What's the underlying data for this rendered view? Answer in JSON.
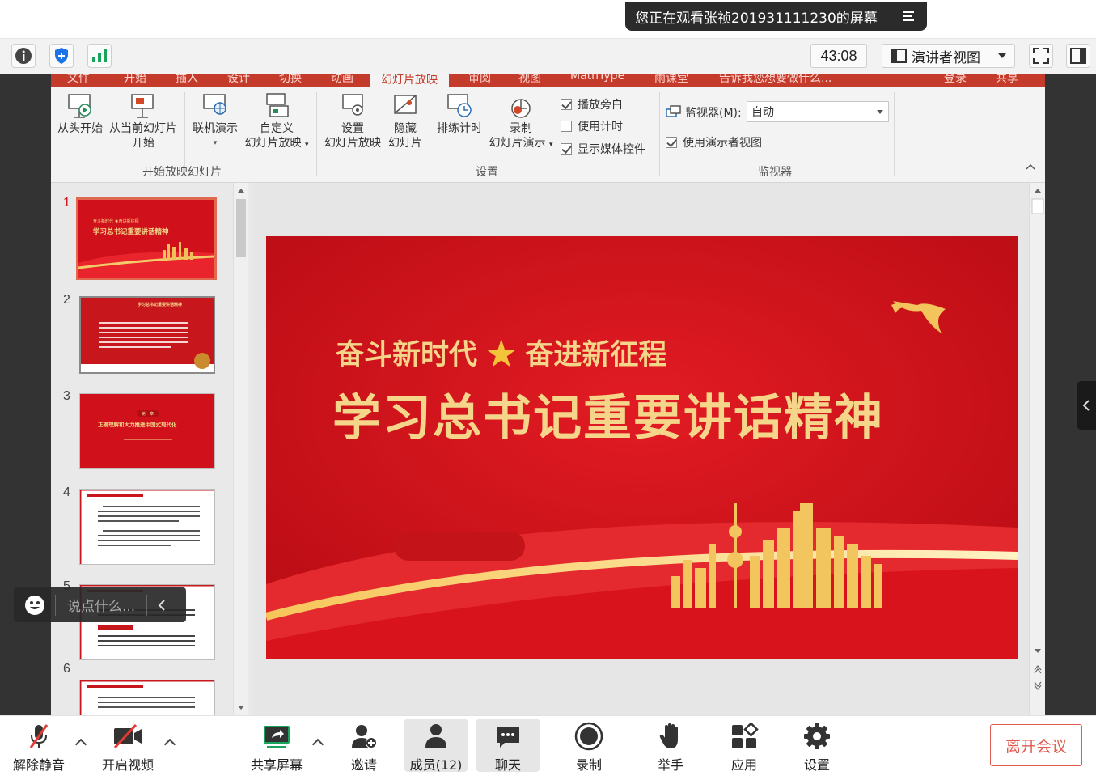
{
  "sharing_banner": {
    "text": "您正在观看张祯201931111230的屏幕",
    "menu_icon": "menu-lines-icon"
  },
  "meeting_bar": {
    "timer": "43:08",
    "view_mode": "演讲者视图",
    "icons": [
      "info-icon",
      "shield-icon",
      "signal-icon",
      "fullscreen-icon",
      "side-panel-icon"
    ]
  },
  "ppt": {
    "tabs": [
      "文件",
      "开始",
      "插入",
      "设计",
      "切换",
      "动画",
      "幻灯片放映",
      "审阅",
      "视图",
      "MathType",
      "雨课堂",
      "告诉我您想要做什么...",
      "登录",
      "共享"
    ],
    "buttons": {
      "from_start": "从头开始",
      "from_current_1": "从当前幻灯片",
      "from_current_2": "开始",
      "online": "联机演示",
      "custom_1": "自定义",
      "custom_2": "幻灯片放映",
      "setup_1": "设置",
      "setup_2": "幻灯片放映",
      "hide_1": "隐藏",
      "hide_2": "幻灯片",
      "rehearse": "排练计时",
      "record_1": "录制",
      "record_2": "幻灯片演示"
    },
    "checkboxes": [
      {
        "label": "播放旁白",
        "checked": true
      },
      {
        "label": "使用计时",
        "checked": false
      },
      {
        "label": "显示媒体控件",
        "checked": true
      },
      {
        "label": "使用演示者视图",
        "checked": true
      }
    ],
    "monitor_label": "监视器(M):",
    "monitor_value": "自动",
    "groups": [
      "开始放映幻灯片",
      "设置",
      "监视器"
    ],
    "slide_numbers": [
      "1",
      "2",
      "3",
      "4",
      "5",
      "6"
    ],
    "selected_slide": 1,
    "thumb_texts": {
      "t1_small": "奋斗新时代 ★奋进新征程",
      "t1_title": "学习总书记重要讲话精神",
      "t2_title": "学习总书记重要讲话精神",
      "t3_badge": "第一章",
      "t3_title": "正确理解和大力推进中国式现代化"
    },
    "slide": {
      "subtitle_left": "奋斗新时代",
      "star": "★",
      "subtitle_right": "奋进新征程",
      "title": "学习总书记重要讲话精神"
    }
  },
  "chat_overlay": {
    "placeholder": "说点什么..."
  },
  "toolbar": {
    "unmute": "解除静音",
    "start_video": "开启视频",
    "share_screen": "共享屏幕",
    "invite": "邀请",
    "members": "成员(12)",
    "chat": "聊天",
    "record": "录制",
    "raise_hand": "举手",
    "apps": "应用",
    "settings": "设置",
    "leave": "离开会议"
  },
  "colors": {
    "accent_red": "#c8161d",
    "gold": "#f3d48a",
    "leave": "#e05a4f",
    "share_green": "#1aa35a"
  }
}
